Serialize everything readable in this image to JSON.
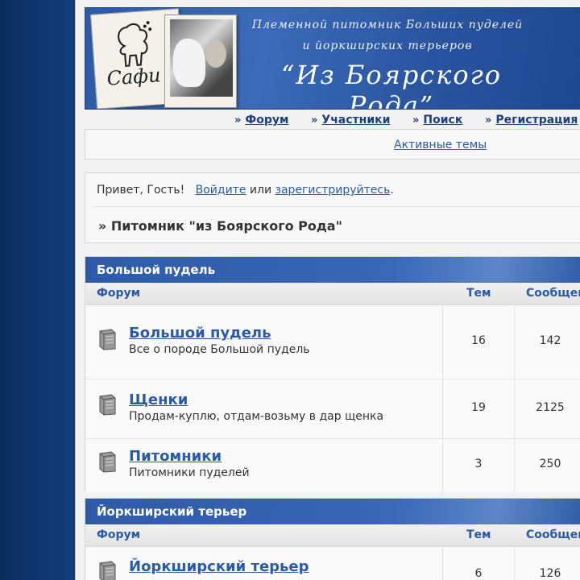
{
  "banner": {
    "logo_text": "Сафи",
    "tagline_line1": "Племенной питомник Больших пуделей",
    "tagline_line2": "и йоркширских терьеров",
    "brand": "“Из Боярского Рода”"
  },
  "nav": {
    "items": [
      {
        "label": "Форум"
      },
      {
        "label": "Участники"
      },
      {
        "label": "Поиск"
      },
      {
        "label": "Регистрация"
      }
    ],
    "arrow": "»"
  },
  "active_topics": "Активные темы",
  "welcome": {
    "greeting": "Привет, Гость!",
    "login_link": "Войдите",
    "or": "или",
    "register_link": "зарегистрируйтесь",
    "period": ".",
    "breadcrumb": "» Питомник \"из Боярского Рода\""
  },
  "columns": {
    "forum": "Форум",
    "topics": "Тем",
    "posts": "Сообщений"
  },
  "categories": [
    {
      "title": "Большой пудель",
      "forums": [
        {
          "title": "Большой пудель",
          "desc": "Все о породе Большой пудель",
          "topics": "16",
          "posts": "142"
        },
        {
          "title": "Щенки",
          "desc": "Продам-куплю, отдам-возьму в дар щенка",
          "topics": "19",
          "posts": "2125"
        },
        {
          "title": "Питомники",
          "desc": "Питомники пуделей",
          "topics": "3",
          "posts": "250"
        }
      ]
    },
    {
      "title": "Йоркширский терьер",
      "forums": [
        {
          "title": "Йоркширский терьер",
          "desc": "",
          "topics": "6",
          "posts": "126"
        }
      ]
    }
  ],
  "icons": {
    "forum_icon": "book-icon",
    "nav_arrow": "double-chevron-icon"
  },
  "colors": {
    "link": "#2a5aa8",
    "header_blue": "#2e5aa8",
    "left_strip": "#0f3a72"
  }
}
